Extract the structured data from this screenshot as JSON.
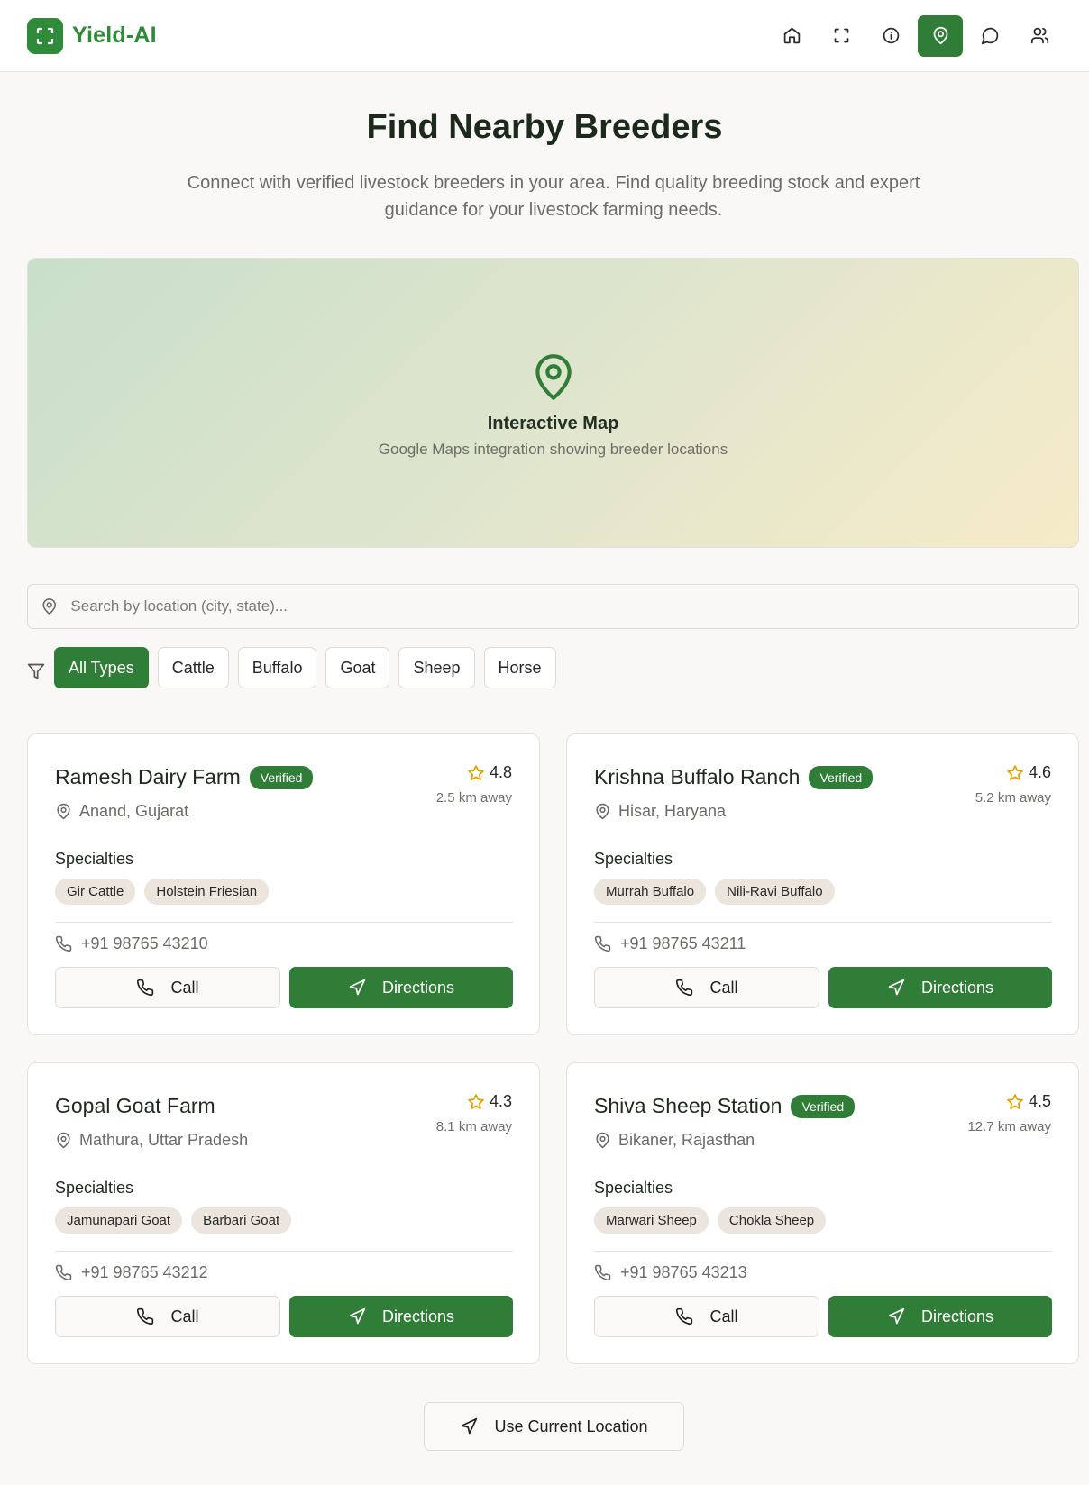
{
  "app": {
    "name": "Yield-AI"
  },
  "nav": [
    {
      "icon": "home-icon",
      "name": "nav-home",
      "active": false
    },
    {
      "icon": "scan-icon",
      "name": "nav-scan",
      "active": false
    },
    {
      "icon": "info-icon",
      "name": "nav-info",
      "active": false
    },
    {
      "icon": "map-pin-icon",
      "name": "nav-breeders",
      "active": true
    },
    {
      "icon": "chat-icon",
      "name": "nav-chat",
      "active": false
    },
    {
      "icon": "users-icon",
      "name": "nav-community",
      "active": false
    }
  ],
  "hero": {
    "title": "Find Nearby Breeders",
    "subtitle": "Connect with verified livestock breeders in your area. Find quality breeding stock and expert guidance for your livestock farming needs."
  },
  "map": {
    "title": "Interactive Map",
    "subtitle": "Google Maps integration showing breeder locations"
  },
  "search": {
    "placeholder": "Search by location (city, state)...",
    "value": ""
  },
  "filters": {
    "options": [
      "All Types",
      "Cattle",
      "Buffalo",
      "Goat",
      "Sheep",
      "Horse"
    ],
    "selected": "All Types"
  },
  "breeders": [
    {
      "name": "Ramesh Dairy Farm",
      "verified": true,
      "verified_label": "Verified",
      "location": "Anand, Gujarat",
      "rating": "4.8",
      "distance": "2.5 km away",
      "specialties_label": "Specialties",
      "specialties": [
        "Gir Cattle",
        "Holstein Friesian"
      ],
      "phone": "+91 98765 43210",
      "call_label": "Call",
      "directions_label": "Directions"
    },
    {
      "name": "Krishna Buffalo Ranch",
      "verified": true,
      "verified_label": "Verified",
      "location": "Hisar, Haryana",
      "rating": "4.6",
      "distance": "5.2 km away",
      "specialties_label": "Specialties",
      "specialties": [
        "Murrah Buffalo",
        "Nili-Ravi Buffalo"
      ],
      "phone": "+91 98765 43211",
      "call_label": "Call",
      "directions_label": "Directions"
    },
    {
      "name": "Gopal Goat Farm",
      "verified": false,
      "verified_label": "",
      "location": "Mathura, Uttar Pradesh",
      "rating": "4.3",
      "distance": "8.1 km away",
      "specialties_label": "Specialties",
      "specialties": [
        "Jamunapari Goat",
        "Barbari Goat"
      ],
      "phone": "+91 98765 43212",
      "call_label": "Call",
      "directions_label": "Directions"
    },
    {
      "name": "Shiva Sheep Station",
      "verified": true,
      "verified_label": "Verified",
      "location": "Bikaner, Rajasthan",
      "rating": "4.5",
      "distance": "12.7 km away",
      "specialties_label": "Specialties",
      "specialties": [
        "Marwari Sheep",
        "Chokla Sheep"
      ],
      "phone": "+91 98765 43213",
      "call_label": "Call",
      "directions_label": "Directions"
    }
  ],
  "current_location_label": "Use Current Location",
  "colors": {
    "brand": "#2f8a3a",
    "accent": "#2f7d36",
    "star": "#e0a100",
    "background": "#f9f8f6"
  }
}
